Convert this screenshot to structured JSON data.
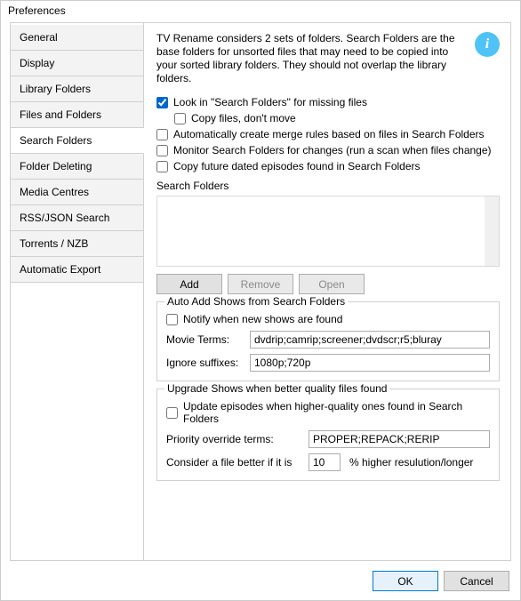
{
  "window": {
    "title": "Preferences"
  },
  "tabs": [
    {
      "label": "General"
    },
    {
      "label": "Display"
    },
    {
      "label": "Library Folders"
    },
    {
      "label": "Files and Folders"
    },
    {
      "label": "Search Folders",
      "active": true
    },
    {
      "label": "Folder Deleting"
    },
    {
      "label": "Media Centres"
    },
    {
      "label": "RSS/JSON Search"
    },
    {
      "label": "Torrents / NZB"
    },
    {
      "label": "Automatic Export"
    }
  ],
  "description": "TV Rename considers 2 sets of folders. Search Folders are the base folders for unsorted files that may need to be copied into your sorted library folders. They should not overlap the library folders.",
  "options": {
    "lookIn": "Look in \"Search Folders\" for missing files",
    "copyNotMove": "Copy files, don't move",
    "autoMerge": "Automatically create merge rules based on files in Search Folders",
    "monitor": "Monitor Search Folders for changes (run a scan when files change)",
    "copyFuture": "Copy future dated episodes found in Search Folders"
  },
  "folderSection": {
    "label": "Search Folders",
    "add": "Add",
    "remove": "Remove",
    "open": "Open"
  },
  "autoAdd": {
    "title": "Auto Add Shows from Search Folders",
    "notify": "Notify when new shows are found",
    "movieTermsLabel": "Movie Terms:",
    "movieTerms": "dvdrip;camrip;screener;dvdscr;r5;bluray",
    "ignoreLabel": "Ignore suffixes:",
    "ignore": "1080p;720p"
  },
  "upgrade": {
    "title": "Upgrade Shows when better quality files found",
    "update": "Update episodes when higher-quality ones found in Search Folders",
    "priorityLabel": "Priority override terms:",
    "priority": "PROPER;REPACK;RERIP",
    "considerLabel": "Consider a file better if it is",
    "considerValue": "10",
    "considerSuffix": "% higher resulution/longer"
  },
  "footer": {
    "ok": "OK",
    "cancel": "Cancel"
  }
}
